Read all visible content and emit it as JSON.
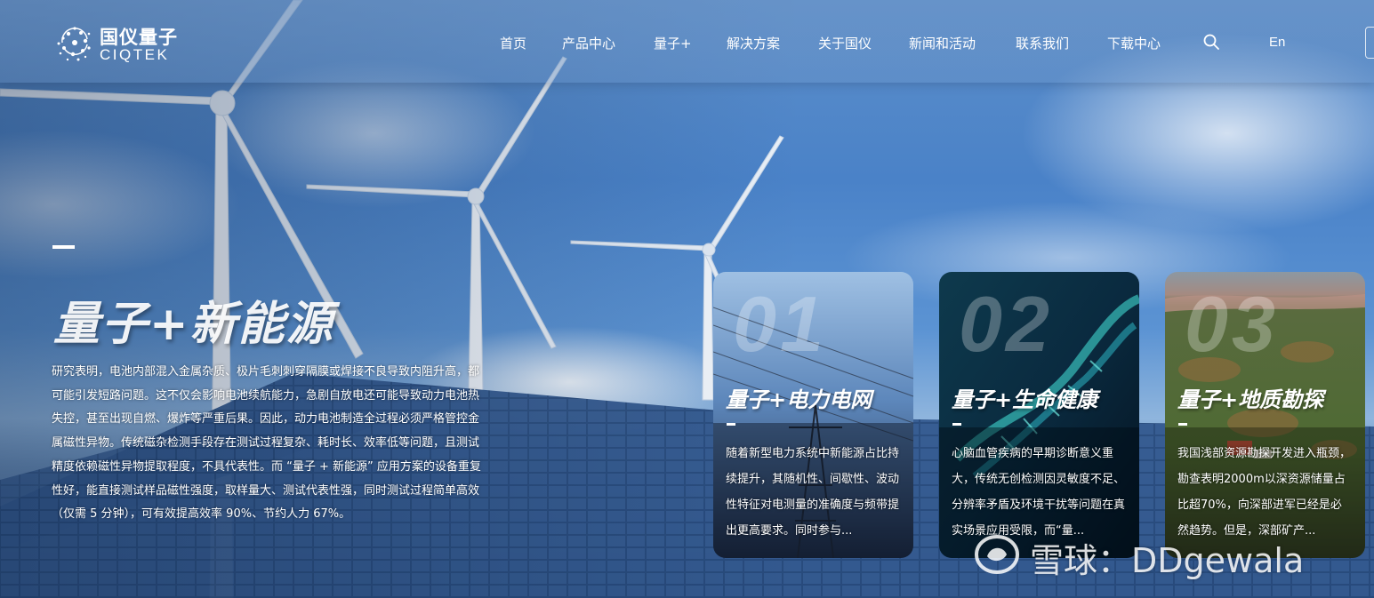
{
  "brand": {
    "name_cn": "国仪量子",
    "name_en": "CIQTEK"
  },
  "nav": {
    "items": [
      "首页",
      "产品中心",
      "量子+",
      "解决方案",
      "关于国仪",
      "新闻和活动",
      "联系我们",
      "下载中心"
    ],
    "language": "En"
  },
  "hero": {
    "title": "量子+新能源",
    "description": "研究表明，电池内部混入金属杂质、极片毛刺刺穿隔膜或焊接不良导致内阻升高，都可能引发短路问题。这不仅会影响电池续航能力，急剧自放电还可能导致动力电池热失控，甚至出现自燃、爆炸等严重后果。因此，动力电池制造全过程必须严格管控金属磁性异物。传统磁杂检测手段存在测试过程复杂、耗时长、效率低等问题，且测试精度依赖磁性异物提取程度，不具代表性。而 “量子 + 新能源” 应用方案的设备重复性好，能直接测试样品磁性强度，取样量大、测试代表性强，同时测试过程简单高效（仅需 5 分钟），可有效提高效率 90%、节约人力 67%。"
  },
  "cards": [
    {
      "number": "01",
      "title": "量子+电力电网",
      "text": "随着新型电力系统中新能源占比持续提升，其随机性、间歇性、波动性特征对电测量的准确度与频带提出更高要求。同时参与..."
    },
    {
      "number": "02",
      "title": "量子+生命健康",
      "text": "心脑血管疾病的早期诊断意义重大，传统无创检测因灵敏度不足、分辨率矛盾及环境干扰等问题在真实场景应用受限，而“量..."
    },
    {
      "number": "03",
      "title": "量子+地质勘探",
      "text": "我国浅部资源勘探开发进入瓶颈，勘查表明2000m以深资源储量占比超70%，向深部进军已经是必然趋势。但是，深部矿产..."
    }
  ],
  "watermark": {
    "text": "雪球：DDgewala"
  },
  "icons": {
    "search": "search-icon",
    "logo": "logo-mark-icon",
    "watermark": "snowball-logo-icon"
  },
  "colors": {
    "sky": "#4a82c8",
    "header_overlay": "#6e96c8",
    "text": "#ffffff"
  }
}
